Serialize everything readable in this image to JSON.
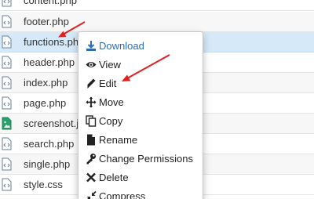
{
  "files": [
    {
      "name": "content.php",
      "type": "php"
    },
    {
      "name": "footer.php",
      "type": "php"
    },
    {
      "name": "functions.php",
      "type": "php"
    },
    {
      "name": "header.php",
      "type": "php"
    },
    {
      "name": "index.php",
      "type": "php"
    },
    {
      "name": "page.php",
      "type": "php"
    },
    {
      "name": "screenshot.jp",
      "type": "image"
    },
    {
      "name": "search.php",
      "type": "php"
    },
    {
      "name": "single.php",
      "type": "php"
    },
    {
      "name": "style.css",
      "type": "css"
    }
  ],
  "context_menu": {
    "items": [
      {
        "label": "Download",
        "icon": "download-icon"
      },
      {
        "label": "View",
        "icon": "eye-icon"
      },
      {
        "label": "Edit",
        "icon": "pencil-icon"
      },
      {
        "label": "Move",
        "icon": "move-icon"
      },
      {
        "label": "Copy",
        "icon": "copy-icon"
      },
      {
        "label": "Rename",
        "icon": "file-icon"
      },
      {
        "label": "Change Permissions",
        "icon": "key-icon"
      },
      {
        "label": "Delete",
        "icon": "x-icon"
      },
      {
        "label": "Compress",
        "icon": "compress-icon"
      }
    ]
  },
  "colors": {
    "selected_row": "#d6e9f8",
    "menu_link": "#2d6cb5",
    "annotation_arrow": "#e02020",
    "code_file_icon": "#6a7f96",
    "image_file_icon": "#23a36b"
  }
}
